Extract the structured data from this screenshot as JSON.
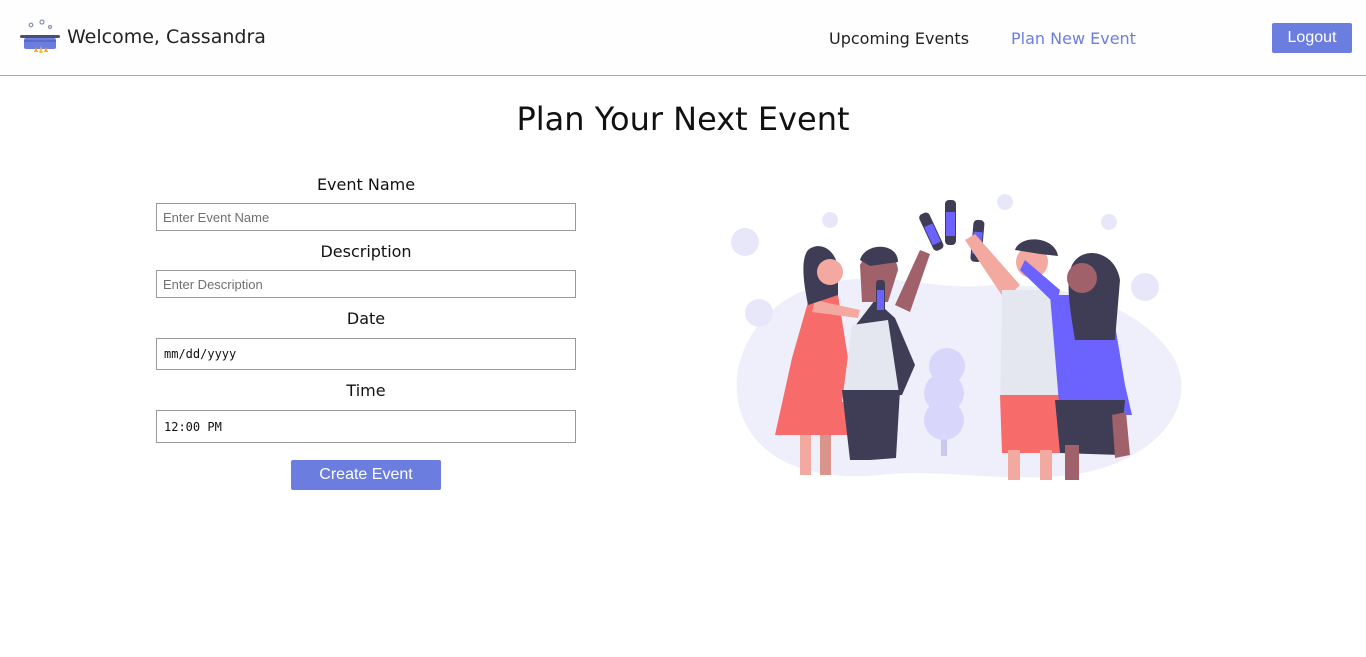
{
  "header": {
    "welcome_text": "Welcome, Cassandra",
    "nav_links": [
      {
        "label": "Upcoming Events",
        "active": false
      },
      {
        "label": "Plan New Event",
        "active": true
      }
    ],
    "logout_label": "Logout",
    "logo_icon": "cooking-pot-icon"
  },
  "main": {
    "title": "Plan Your Next Event",
    "form": {
      "event_name": {
        "label": "Event Name",
        "value": "",
        "placeholder": "Enter Event Name"
      },
      "description": {
        "label": "Description",
        "value": "",
        "placeholder": "Enter Description"
      },
      "date": {
        "label": "Date",
        "value": "mm/dd/yyyy"
      },
      "time": {
        "label": "Time",
        "value": "12:00 PM"
      },
      "submit_label": "Create Event"
    },
    "illustration_icon": "party-celebration-illustration"
  },
  "colors": {
    "accent": "#6b7ee0",
    "illustration_purple": "#6c63ff",
    "illustration_red": "#f86b6b",
    "illustration_dark": "#3f3d56"
  }
}
